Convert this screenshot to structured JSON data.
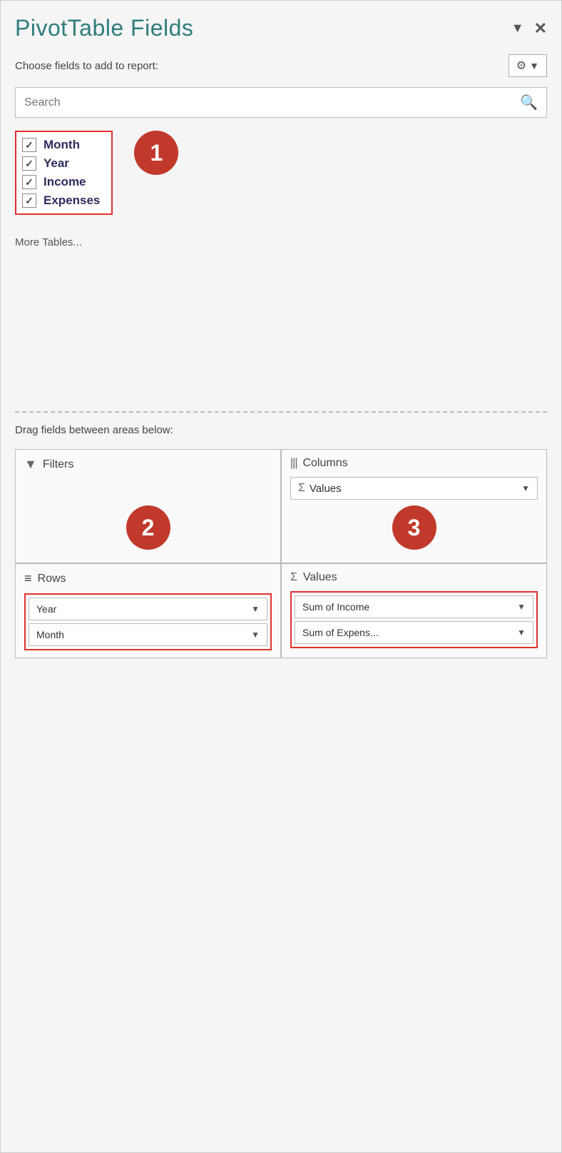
{
  "header": {
    "title": "PivotTable Fields",
    "close_label": "✕",
    "dropdown_arrow": "▼"
  },
  "choose_fields": {
    "label": "Choose fields to add to report:",
    "gear_icon": "⚙",
    "dropdown_arrow": "▼"
  },
  "search": {
    "placeholder": "Search",
    "icon": "🔍"
  },
  "fields": [
    {
      "label": "Month",
      "checked": true
    },
    {
      "label": "Year",
      "checked": true
    },
    {
      "label": "Income",
      "checked": true
    },
    {
      "label": "Expenses",
      "checked": true
    }
  ],
  "badge1": "1",
  "more_tables": "More Tables...",
  "drag_label": "Drag fields between areas below:",
  "areas": {
    "filters": {
      "label": "Filters",
      "icon": "▼"
    },
    "columns": {
      "label": "Columns",
      "icon": "|||",
      "dropdown": {
        "sigma": "Σ",
        "label": "Values",
        "arrow": "▼"
      }
    }
  },
  "badge2": "2",
  "badge3": "3",
  "rows": {
    "label": "Rows",
    "icon": "≡",
    "items": [
      {
        "label": "Year",
        "arrow": "▼"
      },
      {
        "label": "Month",
        "arrow": "▼"
      }
    ]
  },
  "values": {
    "label": "Values",
    "sigma": "Σ",
    "items": [
      {
        "label": "Sum of Income",
        "arrow": "▼"
      },
      {
        "label": "Sum of Expens...",
        "arrow": "▼"
      }
    ]
  }
}
